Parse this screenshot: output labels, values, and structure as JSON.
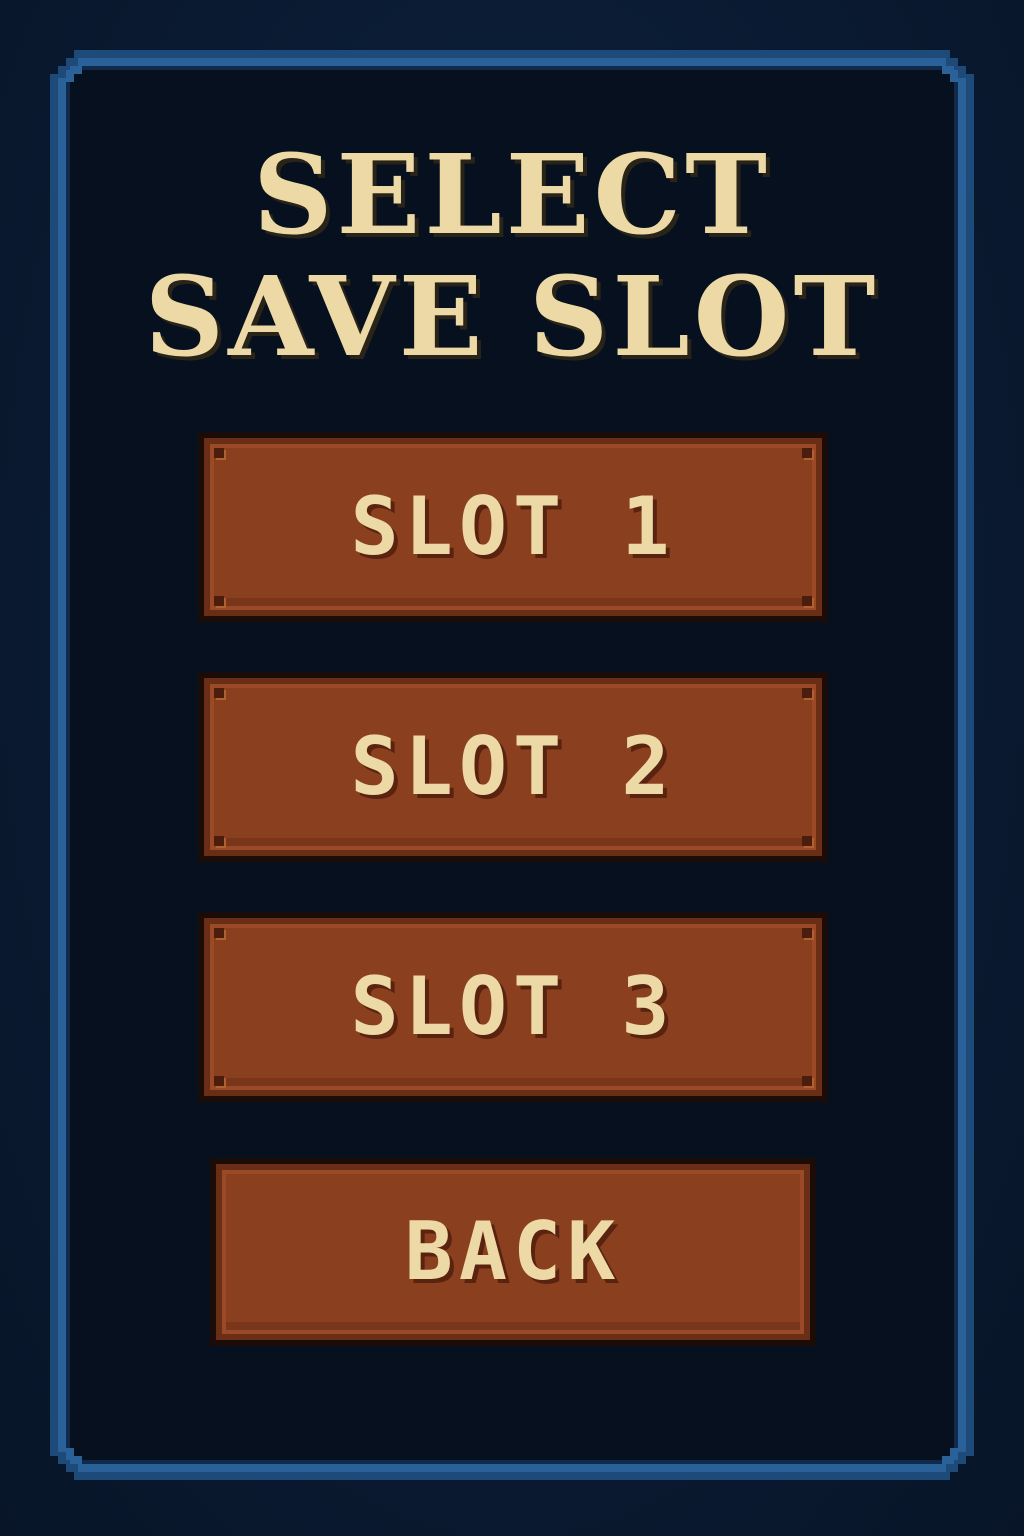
{
  "screen": {
    "title_line1": "SELECT",
    "title_line2": "SAVE SLOT"
  },
  "buttons": {
    "slot1": "SLOT 1",
    "slot2": "SLOT 2",
    "slot3": "SLOT 3",
    "back": "BACK"
  },
  "colors": {
    "background": "#0a1a31",
    "frame": "#2b6199",
    "panel": "#06101e",
    "button_face": "#8a3f1f",
    "text": "#ecd9a6"
  }
}
